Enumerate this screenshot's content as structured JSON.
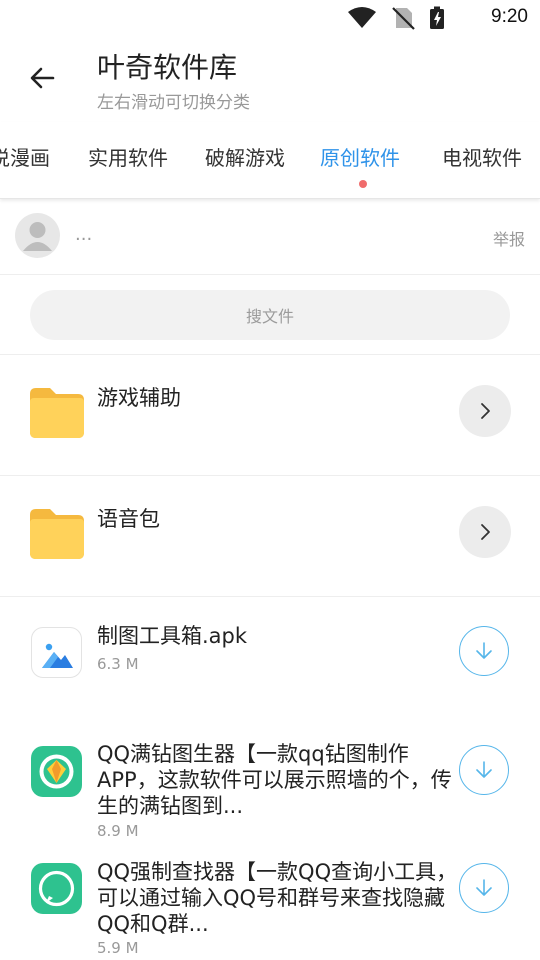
{
  "status": {
    "time": "9:20",
    "icons": [
      "wifi-icon",
      "no-sim-icon",
      "battery-charging-icon"
    ]
  },
  "header": {
    "title": "叶奇软件库",
    "subtitle": "左右滑动可切换分类",
    "back_icon": "arrow-left-icon"
  },
  "tabs": [
    {
      "label": "小说漫画"
    },
    {
      "label": "实用软件"
    },
    {
      "label": "破解游戏"
    },
    {
      "label": "原创软件",
      "active": true
    },
    {
      "label": "电视软件"
    }
  ],
  "colors": {
    "accent": "#2f93e9",
    "indicator": "#f06c6c",
    "download": "#56b6ea"
  },
  "author": {
    "name": "...",
    "report_label": "举报"
  },
  "search": {
    "placeholder": "搜文件"
  },
  "items": [
    {
      "type": "folder",
      "title": "游戏辅助",
      "action": "chevron-right-icon"
    },
    {
      "type": "folder",
      "title": "语音包",
      "action": "chevron-right-icon"
    },
    {
      "type": "file",
      "title": "制图工具箱.apk",
      "size": "6.3 M",
      "icon": "image-app-icon",
      "action": "download-icon"
    },
    {
      "type": "file",
      "title": "QQ满钻图生器【一款qq钻图制作APP，这款软件可以展示照墙的个，传生的满钻图到...",
      "size": "8.9 M",
      "icon": "diamond-app-icon",
      "action": "download-icon"
    },
    {
      "type": "file",
      "title": "QQ强制查找器【一款QQ查询小工具，可以通过输入QQ号和群号来查找隐藏QQ和Q群...",
      "size": "5.9 M",
      "icon": "qq-app-icon",
      "action": "download-icon"
    }
  ]
}
